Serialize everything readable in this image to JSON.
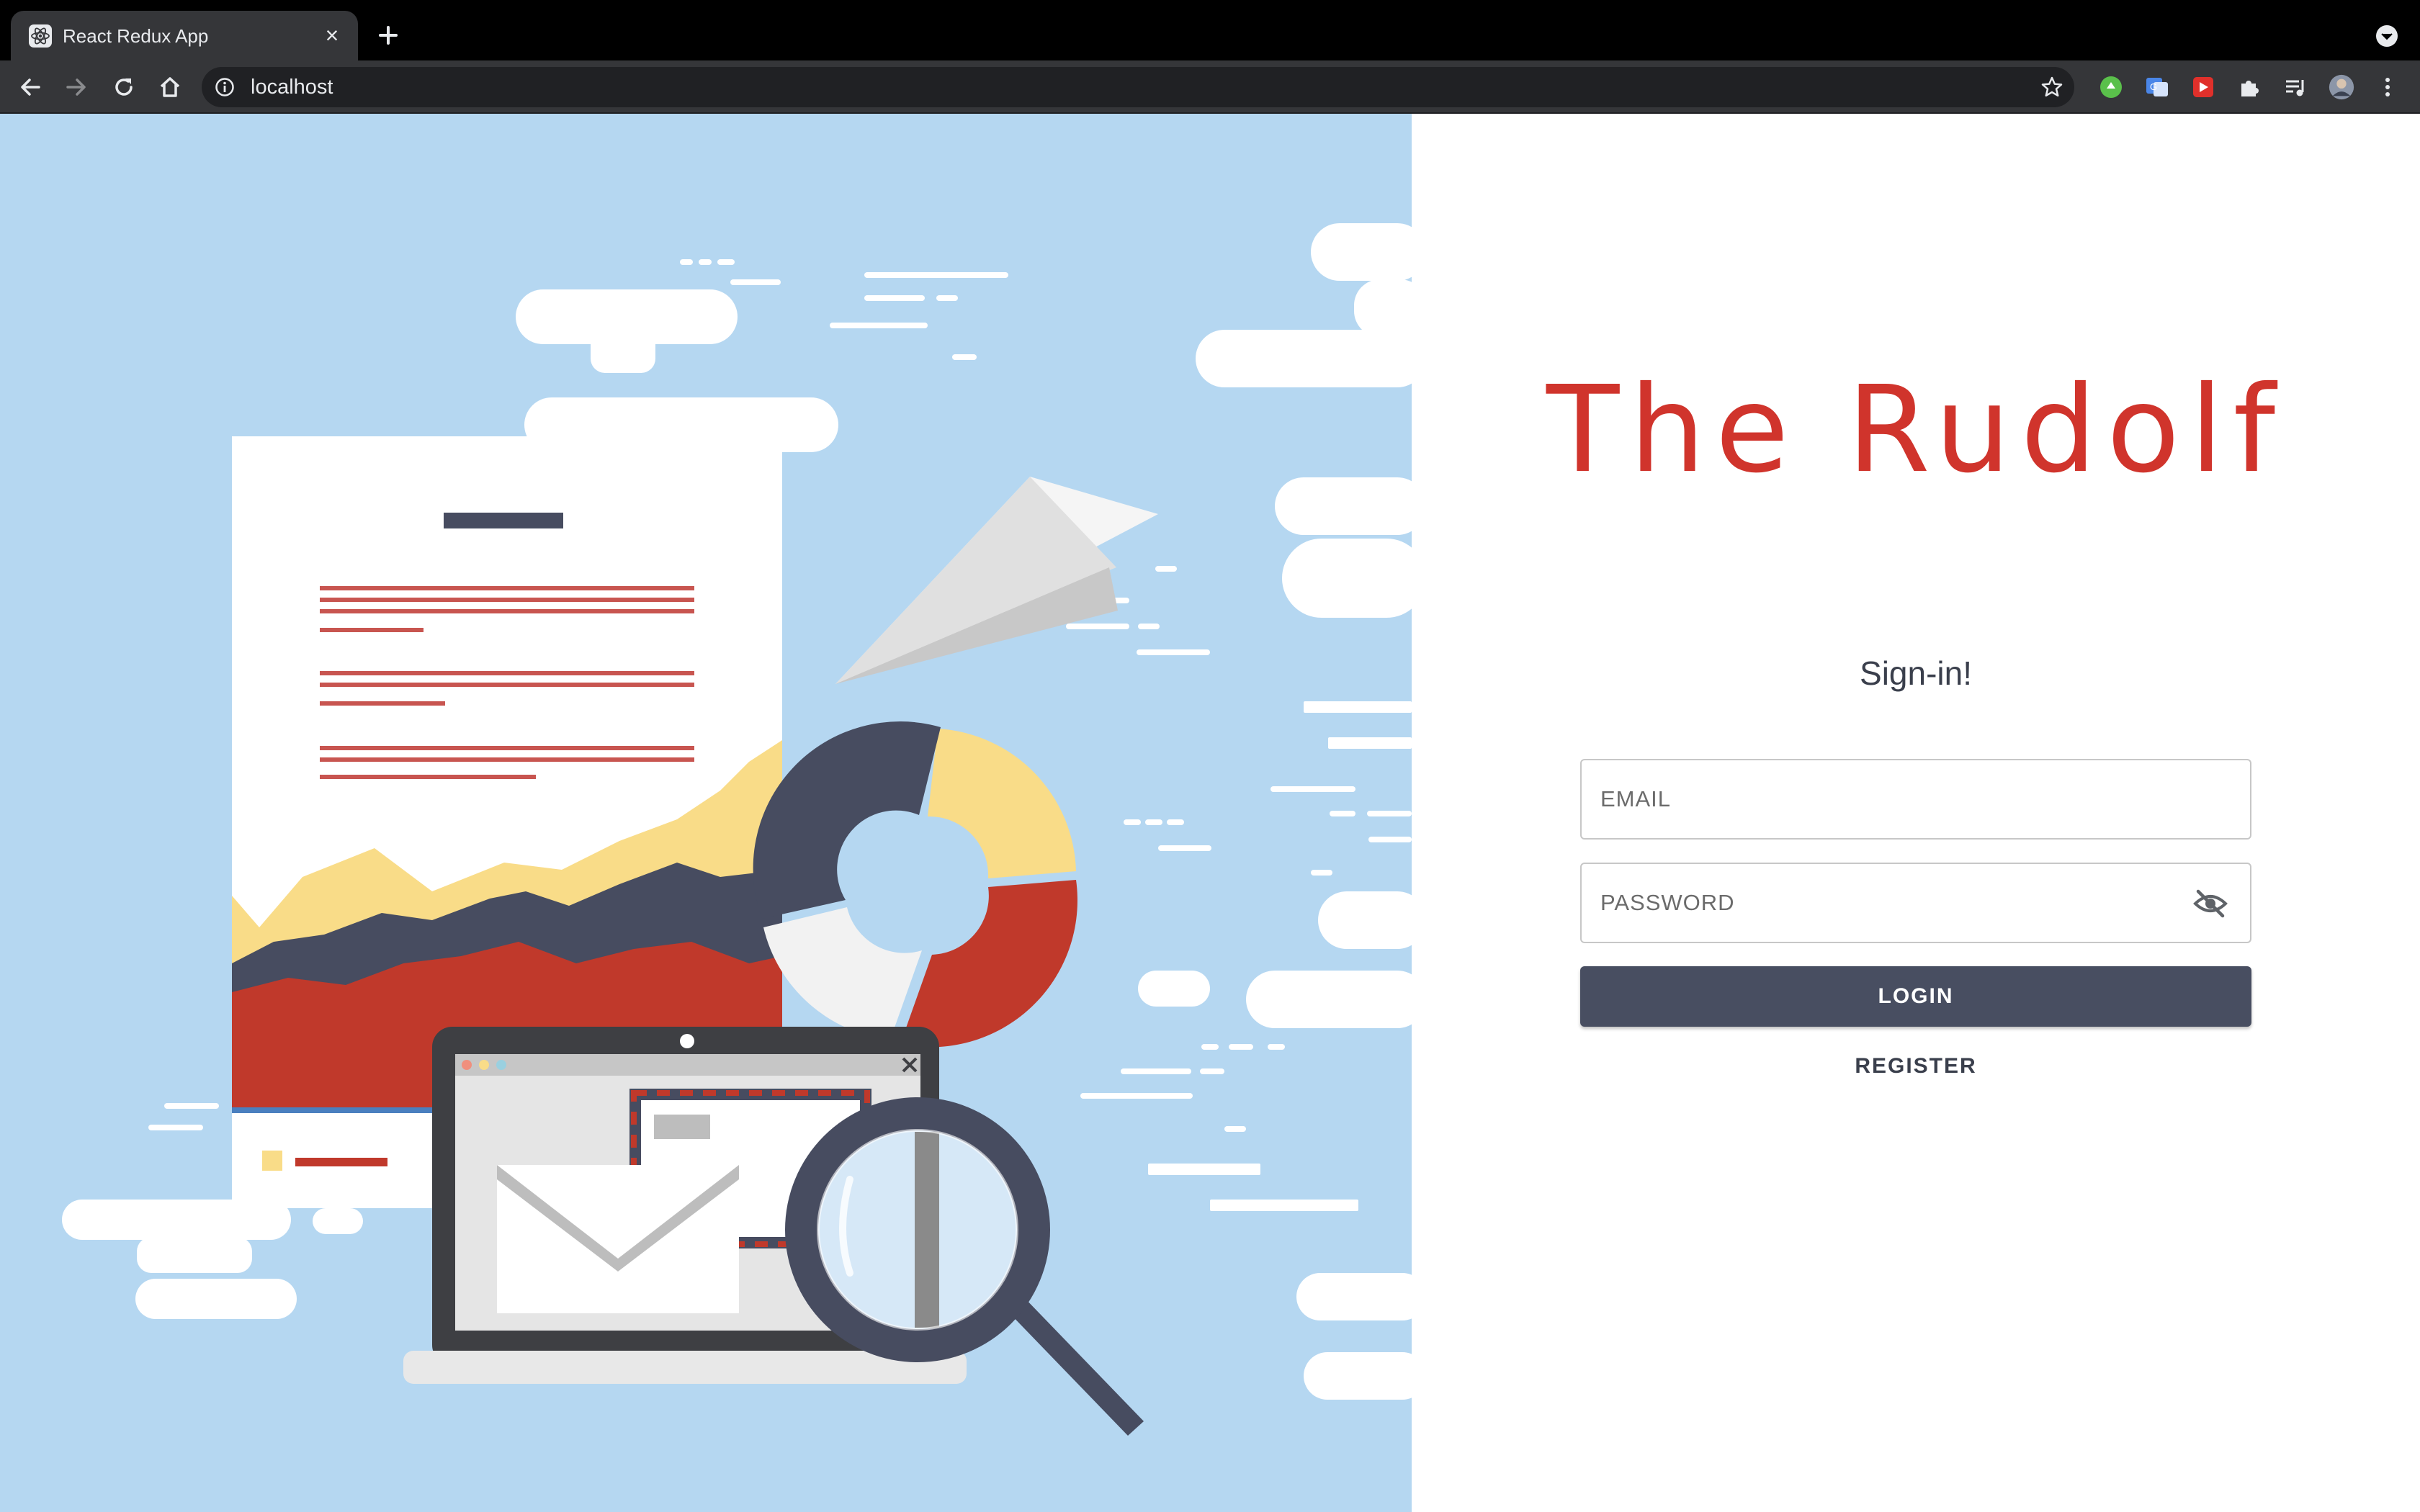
{
  "browser": {
    "tab": {
      "title": "React Redux App",
      "icon": "react-logo-icon"
    },
    "new_tab_icon": "plus-icon",
    "address_bar": {
      "url": "localhost",
      "info_icon": "info-icon"
    },
    "extensions": [
      "green-extension-icon",
      "translate-extension-icon",
      "red-extension-icon",
      "puzzle-extension-icon",
      "media-control-icon",
      "profile-avatar",
      "more-menu-icon"
    ]
  },
  "hero": {
    "illustration": "document-chart-laptop-magnifier-illustration",
    "colors": {
      "background": "#b5d7f1",
      "red": "#c0392b",
      "yellow": "#f9dc88",
      "navy": "#474c60"
    }
  },
  "signin": {
    "brand_title": "The Rudolf",
    "form_title": "Sign-in!",
    "email_placeholder": "EMAIL",
    "password_placeholder": "PASSWORD",
    "password_toggle_icon": "eye-off-icon",
    "login_label": "LOGIN",
    "register_label": "REGISTER",
    "accent_color": "#d0342c",
    "button_color": "#484e61"
  }
}
